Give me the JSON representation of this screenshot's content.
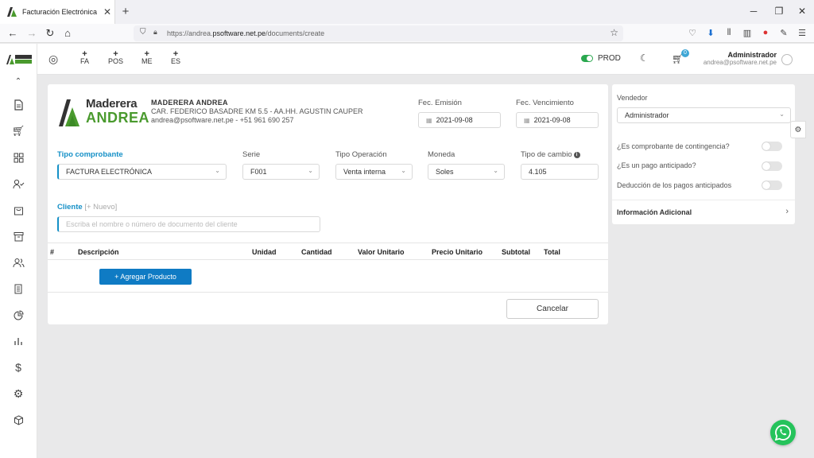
{
  "browser": {
    "tab_title": "Facturación Electrónica",
    "url_prefix": "https://andrea.",
    "url_domain": "psoftware.net.pe",
    "url_path": "/documents/create"
  },
  "topbar": {
    "quick_actions": [
      {
        "plus": "+",
        "label": "FA"
      },
      {
        "plus": "+",
        "label": "POS"
      },
      {
        "plus": "+",
        "label": "ME"
      },
      {
        "plus": "+",
        "label": "ES"
      }
    ],
    "env_label": "PROD",
    "cart_count": "0",
    "user_name": "Administrador",
    "user_email": "andrea@psoftware.net.pe"
  },
  "logo": {
    "line1": "Maderera",
    "line2": "ANDREA",
    "color_dark": "#333333",
    "color_green": "#4a9a2e"
  },
  "company": {
    "name": "MADERERA ANDREA",
    "address": "CAR. FEDERICO BASADRE KM 5.5 - AA.HH. AGUSTIN CAUPER",
    "contact": "andrea@psoftware.net.pe - +51 961 690 257"
  },
  "dates": {
    "emission_label": "Fec. Emisión",
    "emission_value": "2021-09-08",
    "due_label": "Fec. Vencimiento",
    "due_value": "2021-09-08"
  },
  "form": {
    "tipo_label": "Tipo comprobante",
    "tipo_value": "FACTURA ELECTRÓNICA",
    "serie_label": "Serie",
    "serie_value": "F001",
    "operacion_label": "Tipo Operación",
    "operacion_value": "Venta interna",
    "moneda_label": "Moneda",
    "moneda_value": "Soles",
    "cambio_label": "Tipo de cambio",
    "cambio_value": "4.105",
    "cliente_label": "Cliente",
    "cliente_new": "[+ Nuevo]",
    "cliente_placeholder": "Escriba el nombre o número de documento del cliente"
  },
  "table": {
    "headers": [
      "#",
      "Descripción",
      "Unidad",
      "Cantidad",
      "Valor Unitario",
      "Precio Unitario",
      "Subtotal",
      "Total"
    ]
  },
  "actions": {
    "add_product": "+ Agregar Producto",
    "cancel": "Cancelar"
  },
  "panel": {
    "vendedor_label": "Vendedor",
    "vendedor_value": "Administrador",
    "toggles": [
      "¿Es comprobante de contingencia?",
      "¿Es un pago anticipado?",
      "Deducción de los pagos anticipados"
    ],
    "info_label": "Información Adicional"
  },
  "colors": {
    "accent": "#1590c7",
    "primary_button": "#0f7bc4",
    "prod_toggle": "#2aa84f",
    "whatsapp": "#25c35b"
  }
}
